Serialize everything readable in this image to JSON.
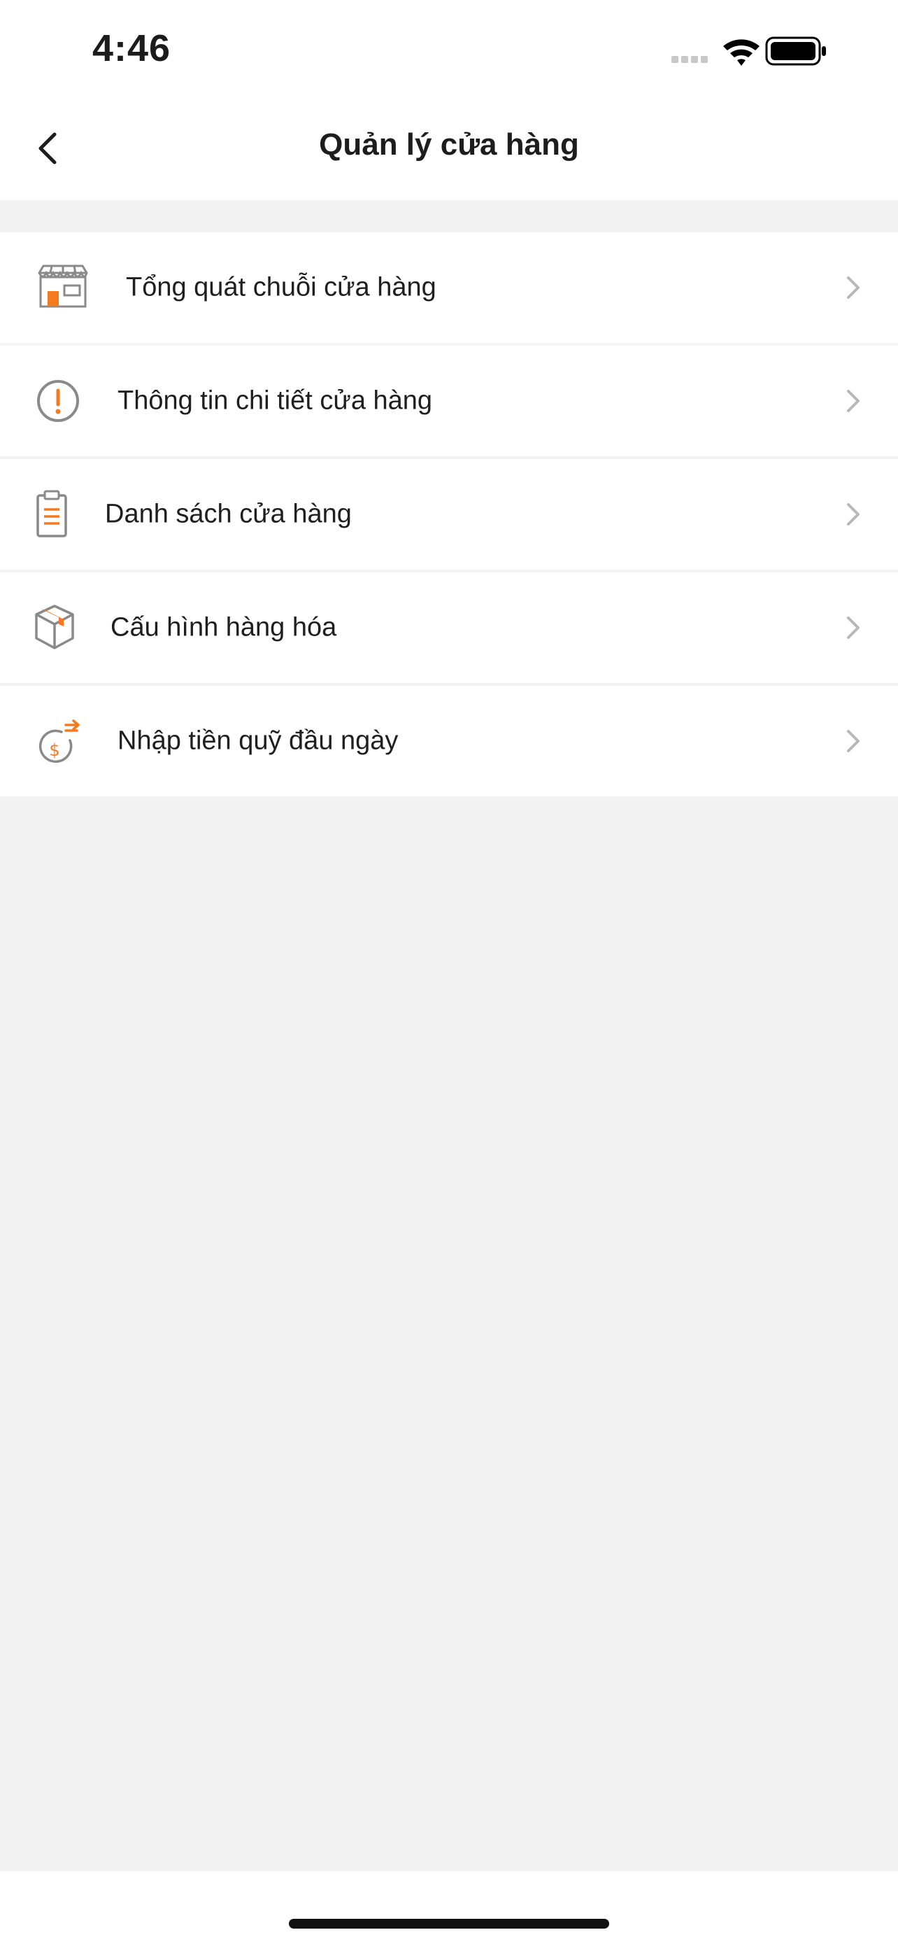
{
  "status_bar": {
    "time": "4:46",
    "icons": [
      "cellular-signal-icon",
      "wifi-icon",
      "battery-icon"
    ]
  },
  "header": {
    "title": "Quản lý cửa hàng",
    "back_icon": "chevron-left-icon"
  },
  "menu": {
    "items": [
      {
        "label": "Tổng quát chuỗi cửa hàng",
        "icon": "storefront-icon"
      },
      {
        "label": "Thông tin chi tiết cửa hàng",
        "icon": "info-alert-icon"
      },
      {
        "label": "Danh sách cửa hàng",
        "icon": "clipboard-list-icon"
      },
      {
        "label": "Cấu hình hàng hóa",
        "icon": "package-box-icon"
      },
      {
        "label": "Nhập tiền quỹ đầu ngày",
        "icon": "cash-fund-icon"
      }
    ]
  },
  "colors": {
    "accent": "#F47A20",
    "icon_gray": "#8A8A8A",
    "chevron": "#B8B8B8",
    "background": "#F3F3F3"
  }
}
